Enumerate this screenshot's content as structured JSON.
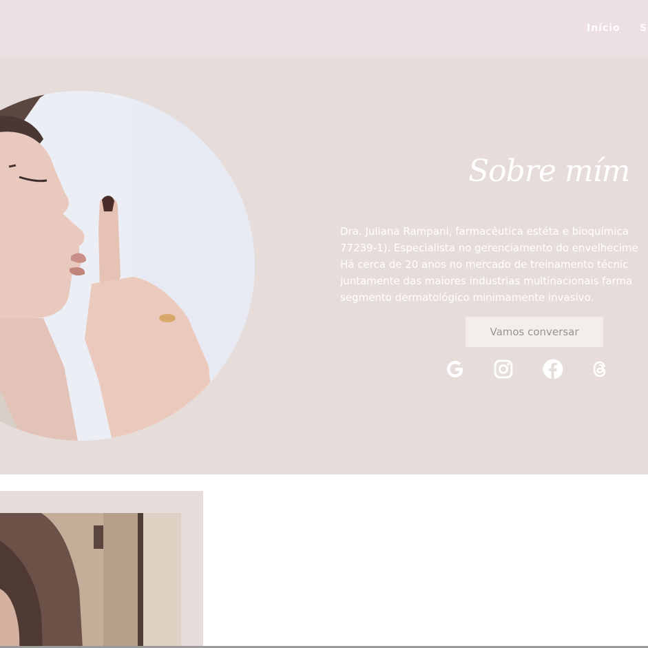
{
  "nav": {
    "items": [
      "Início",
      "So"
    ]
  },
  "about": {
    "title": "Sobre mím",
    "lines": [
      "Dra. Juliana Rampani, farmacêutica estéta e bioquímica",
      "77239-1). Especialista no gerenciamento do envelhecime",
      "Há cerca de 20 anos no mercado de treinamento técnic",
      "juntamente das maiores industrias multinacionais farma",
      "segmento dermatológico minimamente invasivo."
    ],
    "cta_label": "Vamos conversar"
  },
  "social": {
    "icons": [
      "google-icon",
      "instagram-icon",
      "facebook-icon",
      "threads-icon"
    ]
  },
  "colors": {
    "header_bg": "#ece0e3",
    "hero_bg": "#e6dcd9",
    "text_light": "#ffffff",
    "button_bg": "#f3eeec",
    "button_text": "#9c9290"
  }
}
